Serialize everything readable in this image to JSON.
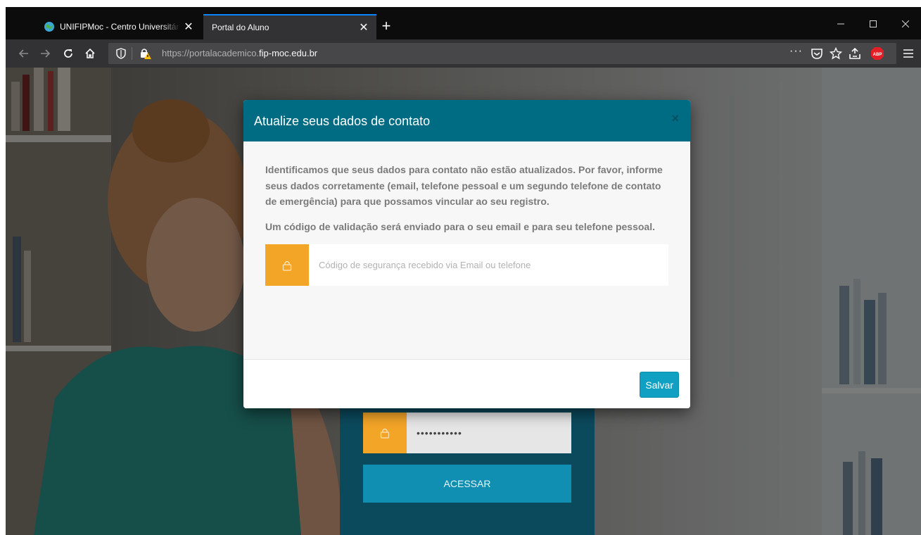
{
  "browser": {
    "tabs": [
      {
        "title": "UNIFIPMoc - Centro Universitário",
        "favicon": "globe-icon",
        "active": false
      },
      {
        "title": "Portal do Aluno",
        "active": true
      }
    ],
    "url": {
      "scheme": "https://",
      "subdomain": "portalacademico.",
      "host": "fip-moc.edu.br"
    },
    "accent_color": "#0a84ff"
  },
  "login_form": {
    "password_value": "•••••••••••",
    "submit_label": "ACESSAR"
  },
  "modal": {
    "title": "Atualize seus dados de contato",
    "close_symbol": "×",
    "paragraph1": "Identificamos que seus dados para contato não estão atualizados. Por favor, informe seus dados corretamente (email, telefone pessoal e um segundo telefone de contato de emergência) para que possamos vincular ao seu registro.",
    "paragraph2": "Um código de validação será enviado para o seu email e para seu telefone pessoal.",
    "code_placeholder": "Código de segurança recebido via Email ou telefone",
    "save_label": "Salvar",
    "header_color": "#006c83",
    "addon_color": "#f3a528",
    "button_color": "#10a0c1"
  }
}
